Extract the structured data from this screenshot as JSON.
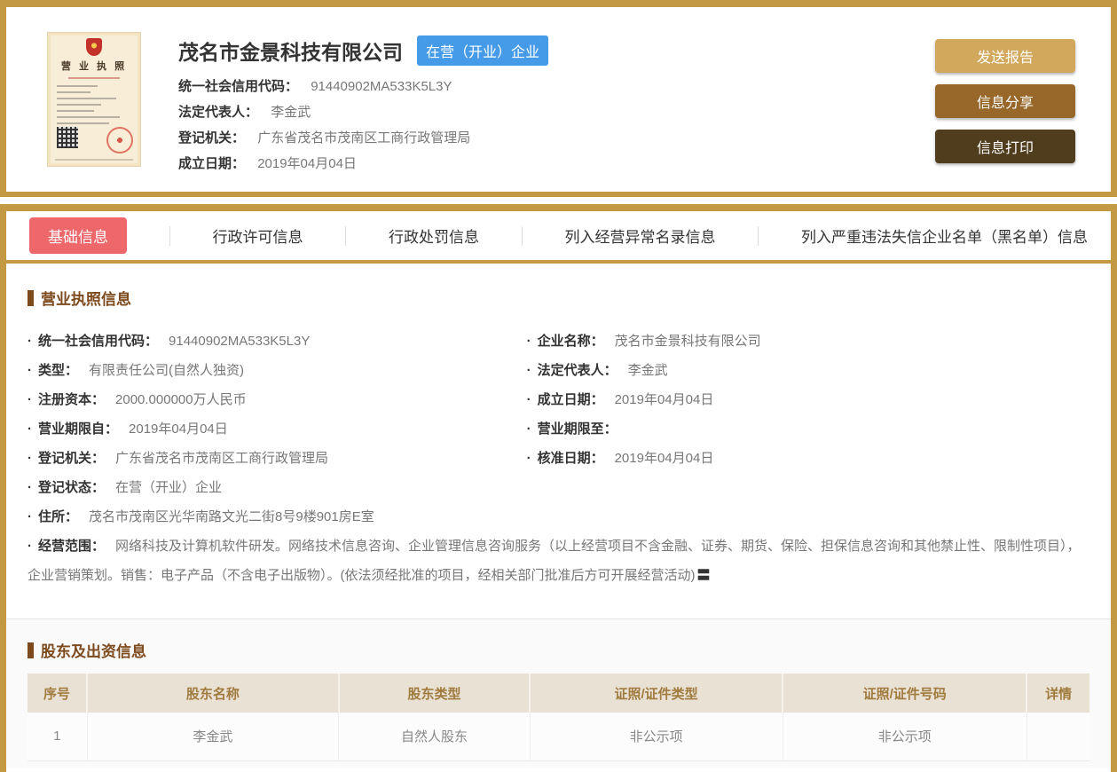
{
  "colors": {
    "gold_border": "#C39A43",
    "active_tab": "#EE676B",
    "badge_blue": "#459BE8",
    "section_title_brown": "#7D4A1E",
    "table_header_bg": "#EAE1D5",
    "table_header_text": "#A07B3E",
    "btn_send": "#D2A85C",
    "btn_share": "#98682B",
    "btn_print": "#503D1E"
  },
  "header": {
    "company_name": "茂名市金景科技有限公司",
    "status_badge": "在营（开业）企业",
    "license_image": {
      "title": "营 业 执 照"
    },
    "fields": [
      {
        "label": "统一社会信用代码：",
        "value": "91440902MA533K5L3Y"
      },
      {
        "label": "法定代表人：",
        "value": "李金武"
      },
      {
        "label": "登记机关：",
        "value": "广东省茂名市茂南区工商行政管理局"
      },
      {
        "label": "成立日期：",
        "value": "2019年04月04日"
      }
    ],
    "buttons": [
      {
        "label": "发送报告"
      },
      {
        "label": "信息分享"
      },
      {
        "label": "信息打印"
      }
    ]
  },
  "tabs": [
    {
      "label": "基础信息",
      "active": true
    },
    {
      "label": "行政许可信息",
      "active": false
    },
    {
      "label": "行政处罚信息",
      "active": false
    },
    {
      "label": "列入经营异常名录信息",
      "active": false
    },
    {
      "label": "列入严重违法失信企业名单（黑名单）信息",
      "active": false
    }
  ],
  "license_section": {
    "title": "营业执照信息",
    "bullet": "·",
    "scope_expand_icon": "〓",
    "fields": [
      {
        "label": "统一社会信用代码：",
        "value": "91440902MA533K5L3Y"
      },
      {
        "label": "企业名称：",
        "value": "茂名市金景科技有限公司"
      },
      {
        "label": "类型：",
        "value": "有限责任公司(自然人独资)"
      },
      {
        "label": "法定代表人：",
        "value": "李金武"
      },
      {
        "label": "注册资本：",
        "value": "2000.000000万人民币"
      },
      {
        "label": "成立日期：",
        "value": "2019年04月04日"
      },
      {
        "label": "营业期限自：",
        "value": "2019年04月04日"
      },
      {
        "label": "营业期限至：",
        "value": ""
      },
      {
        "label": "登记机关：",
        "value": "广东省茂名市茂南区工商行政管理局"
      },
      {
        "label": "核准日期：",
        "value": "2019年04月04日"
      },
      {
        "label": "登记状态：",
        "value": "在营（开业）企业"
      },
      {
        "label": "住所：",
        "value": "茂名市茂南区光华南路文光二街8号9楼901房E室"
      },
      {
        "label": "经营范围：",
        "value": "网络科技及计算机软件研发。网络技术信息咨询、企业管理信息咨询服务（以上经营项目不含金融、证券、期货、保险、担保信息咨询和其他禁止性、限制性项目），企业营销策划。销售：电子产品（不含电子出版物）。(依法须经批准的项目，经相关部门批准后方可开展经营活动)"
      }
    ]
  },
  "shareholder_section": {
    "title": "股东及出资信息",
    "table": {
      "headers": [
        "序号",
        "股东名称",
        "股东类型",
        "证照/证件类型",
        "证照/证件号码",
        "详情"
      ],
      "rows": [
        [
          "1",
          "李金武",
          "自然人股东",
          "非公示项",
          "非公示项",
          ""
        ]
      ]
    }
  }
}
